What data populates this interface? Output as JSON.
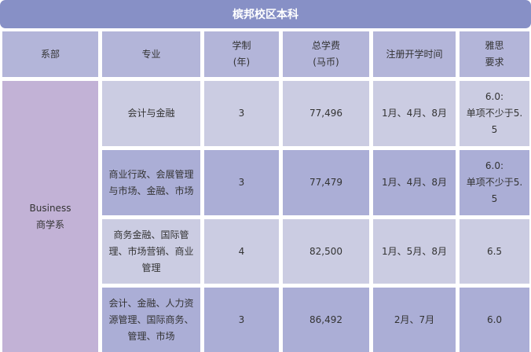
{
  "title": "槟邦校区本科",
  "headers": {
    "department": "系部",
    "major": "专业",
    "duration": "学制\n(年)",
    "tuition": "总学费\n(马币)",
    "intake": "注册开学时间",
    "ielts": "雅思\n要求"
  },
  "department": "Business\n商学系",
  "rows": [
    {
      "major": "会计与金融",
      "duration": "3",
      "tuition": "77,496",
      "intake": "1月、4月、8月",
      "ielts": "6.0:\n单项不少于5.\n5"
    },
    {
      "major": "商业行政、会展管理\n与市场、金融、市场",
      "duration": "3",
      "tuition": "77,479",
      "intake": "1月、4月、8月",
      "ielts": "6.0:\n单项不少于5.\n5"
    },
    {
      "major": "商务金融、国际管\n理、市场营销、商业\n管理",
      "duration": "4",
      "tuition": "82,500",
      "intake": "1月、5月、8月",
      "ielts": "6.5"
    },
    {
      "major": "会计、金融、人力资\n源管理、国际商务、\n管理、市场",
      "duration": "3",
      "tuition": "86,492",
      "intake": "2月、7月",
      "ielts": "6.0"
    }
  ]
}
